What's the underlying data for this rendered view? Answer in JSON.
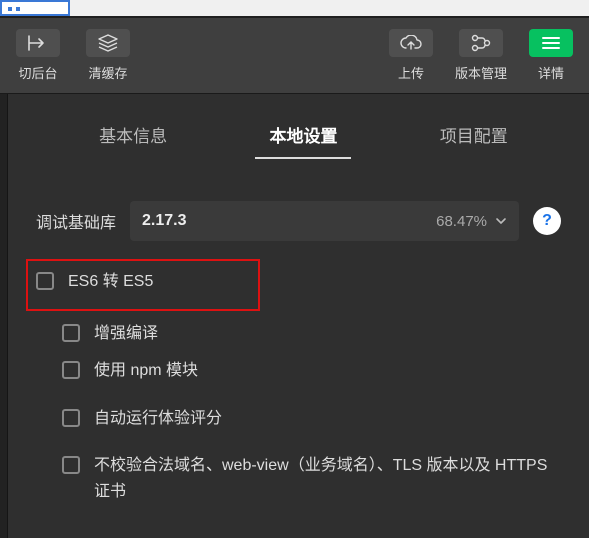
{
  "toolbar": {
    "back_label": "切后台",
    "clear_label": "清缓存",
    "upload_label": "上传",
    "version_label": "版本管理",
    "detail_label": "详情"
  },
  "tabs": {
    "basic": "基本信息",
    "local": "本地设置",
    "project": "项目配置"
  },
  "baselib": {
    "label": "调试基础库",
    "value": "2.17.3",
    "percent": "68.47%"
  },
  "help_glyph": "?",
  "options": {
    "es6": "ES6 转 ES5",
    "enhance": "增强编译",
    "npm": "使用 npm 模块",
    "autoscore": "自动运行体验评分",
    "nocheck": "不校验合法域名、web-view（业务域名）、TLS 版本以及 HTTPS 证书"
  },
  "highlight": {
    "target": "es6"
  }
}
